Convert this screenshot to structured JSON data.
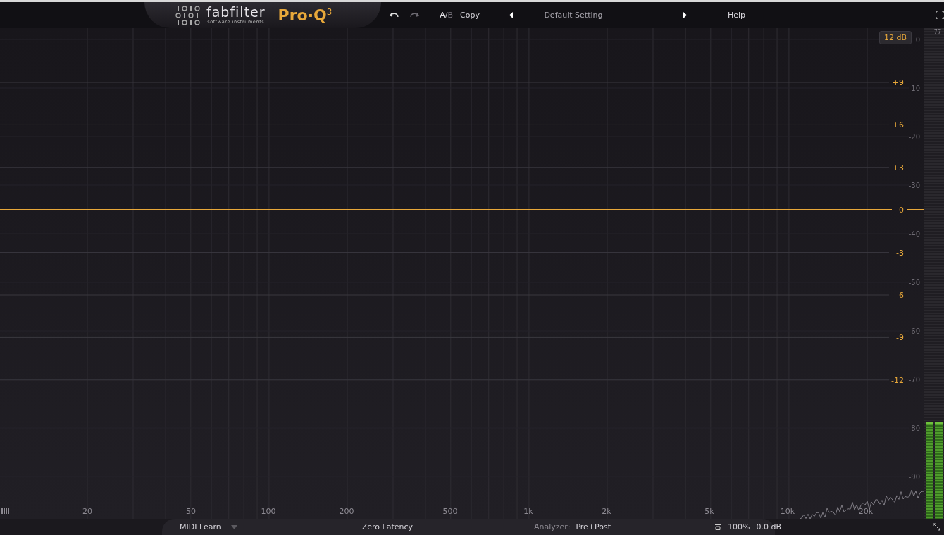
{
  "header": {
    "logo_wordmark": "fabfilter",
    "logo_tagline": "software instruments",
    "product": "Pro·Q$^{3}$",
    "ab": {
      "options": [
        {
          "label": "A",
          "selected": true
        },
        {
          "label": "B",
          "selected": false
        }
      ],
      "separator": "/"
    },
    "copy": "Copy",
    "preset": "Default Setting",
    "help": "Help"
  },
  "graph": {
    "range": "12 dB",
    "frequency_labels": [
      "20",
      "50",
      "100",
      "200",
      "500",
      "1k",
      "2k",
      "5k",
      "10k",
      "20k"
    ],
    "gain_labels": [
      "+9",
      "+6",
      "+3",
      "0",
      "-3",
      "-6",
      "-9",
      "-12"
    ],
    "analyzer_labels": [
      "0",
      "-10",
      "-20",
      "-30",
      "-40",
      "-50",
      "-60",
      "-70",
      "-80",
      "-90"
    ]
  },
  "meter": {
    "peak": "-77",
    "channels": [
      {
        "level": 0.2
      },
      {
        "level": 0.2
      }
    ]
  },
  "footer": {
    "midi_learn": "MIDI Learn",
    "latency": "Zero Latency",
    "analyzer_label": "Analyzer:",
    "analyzer_value": "Pre+Post",
    "zoom": "100%",
    "output_gain": "0.0 dB"
  }
}
